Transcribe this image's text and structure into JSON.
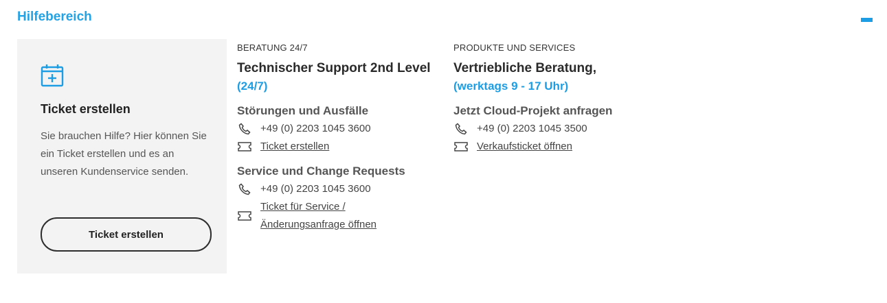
{
  "header": {
    "title": "Hilfebereich"
  },
  "ticket_card": {
    "title": "Ticket erstellen",
    "description": "Sie brauchen Hilfe? Hier können Sie ein Ticket erstellen und es an unseren Kundenservice senden.",
    "button_label": "Ticket erstellen",
    "icon": "calendar-plus-icon"
  },
  "support": {
    "eyebrow": "BERATUNG 24/7",
    "title": "Technischer Support 2nd Level",
    "hours": "(24/7)",
    "sections": [
      {
        "title": "Störungen und Ausfälle",
        "phone": "+49 (0) 2203 1045 3600",
        "link": "Ticket erstellen"
      },
      {
        "title": "Service und Change Requests",
        "phone": "+49 (0) 2203 1045 3600",
        "link_line1": "Ticket für Service /",
        "link_line2": "Änderungsanfrage öffnen"
      }
    ]
  },
  "sales": {
    "eyebrow": "PRODUKTE UND SERVICES",
    "title": "Vertriebliche Beratung,",
    "hours": "(werktags 9 - 17 Uhr)",
    "section_title": "Jetzt Cloud-Projekt anfragen",
    "phone": "+49 (0) 2203 1045 3500",
    "link": "Verkaufsticket öffnen"
  },
  "colors": {
    "accent": "#22a3e6",
    "card_bg": "#f3f3f3",
    "text": "#3b3b3b"
  }
}
